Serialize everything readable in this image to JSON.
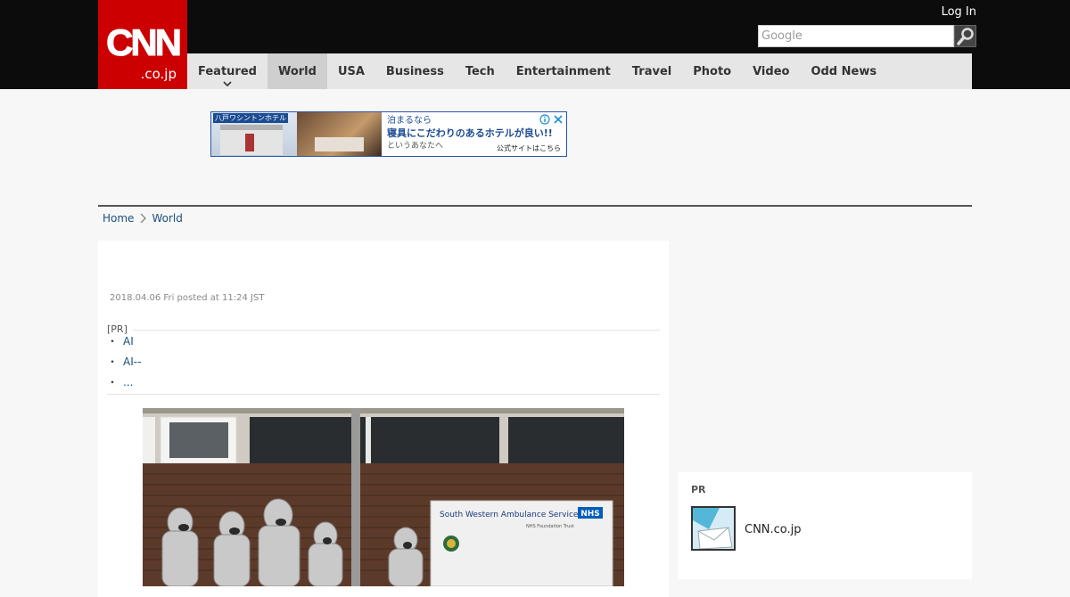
{
  "header": {
    "logo_text_top": "CNN",
    "logo_text_bottom": ".co.jp",
    "login_label": "Log In",
    "search_placeholder": "Google"
  },
  "nav": {
    "items": [
      {
        "label": "Featured",
        "has_dropdown": true
      },
      {
        "label": "World",
        "active": true
      },
      {
        "label": "USA"
      },
      {
        "label": "Business"
      },
      {
        "label": "Tech"
      },
      {
        "label": "Entertainment"
      },
      {
        "label": "Travel"
      },
      {
        "label": "Photo"
      },
      {
        "label": "Video"
      },
      {
        "label": "Odd News"
      }
    ]
  },
  "ad": {
    "hotel_label": "八戸ワシントンホテル",
    "line1": "泊まるなら",
    "line2": "寝具にこだわりのあるホテルが良い!!",
    "line3": "というあなたへ",
    "cta": "公式サイトはこちら"
  },
  "breadcrumb": {
    "home": "Home",
    "section": "World"
  },
  "article": {
    "posted": "2018.04.06 Fri posted at 11:24 JST",
    "pr_label": "[PR]",
    "pr_links": [
      "AI",
      "AI--",
      "..."
    ],
    "photo_sign_title": "South Western Ambulance Service",
    "photo_sign_nhs": "NHS",
    "photo_sign_sub": "NHS Foundation Trust"
  },
  "sidebar": {
    "pr_title": "PR",
    "pr_item_label": "CNN.co.jp"
  },
  "colors": {
    "brand_red": "#cc0000",
    "header_black": "#0c0c0c",
    "link_blue": "#1a4f7a"
  }
}
